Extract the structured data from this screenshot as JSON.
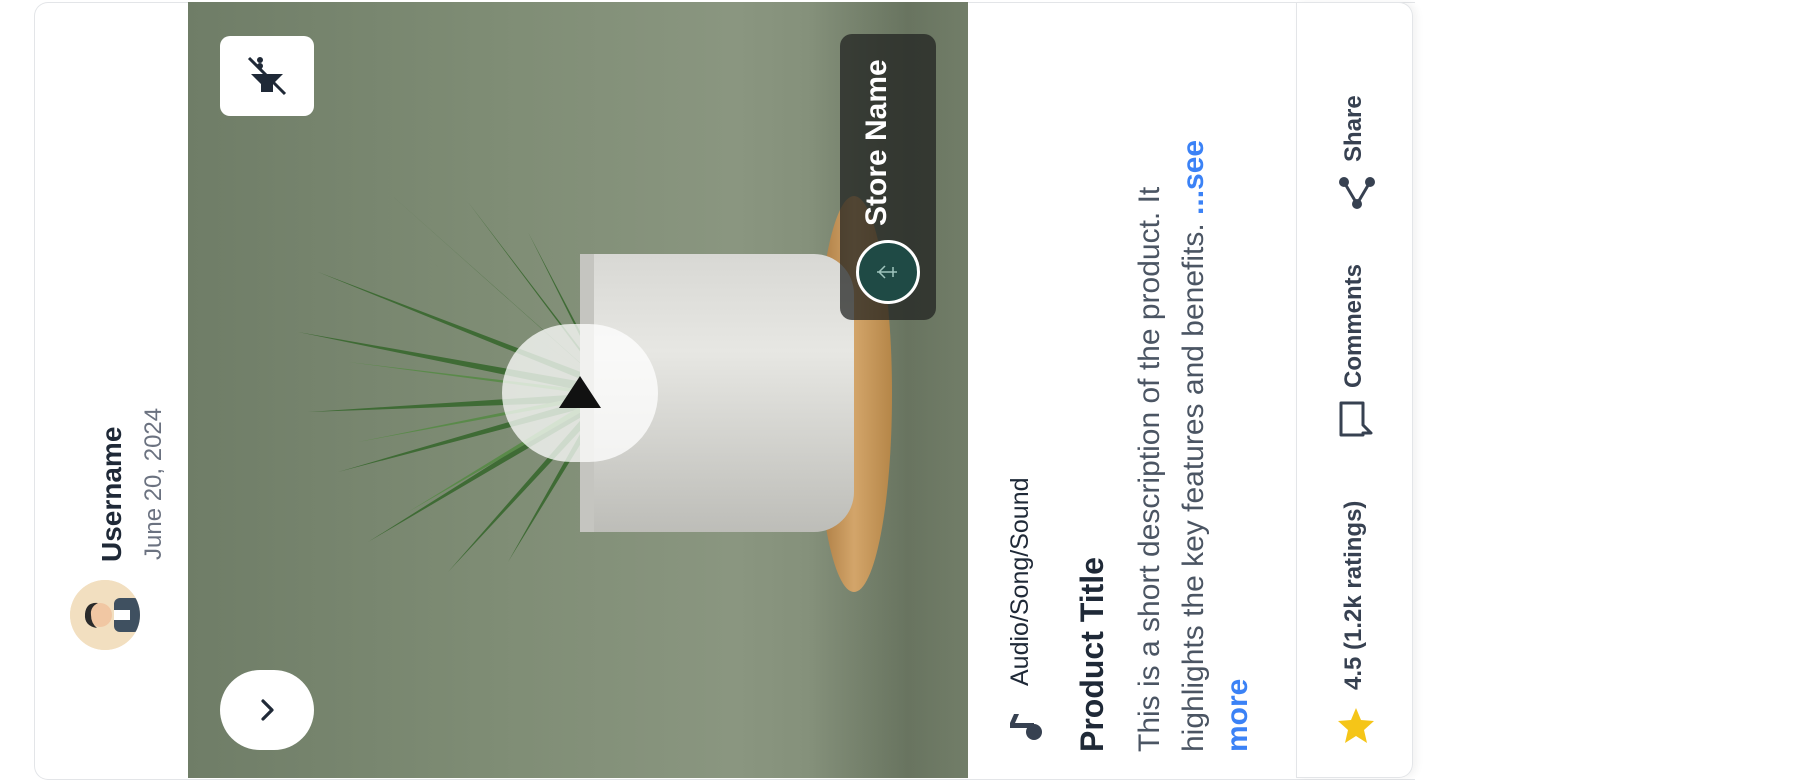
{
  "header": {
    "username": "Username",
    "date": "June 20, 2024"
  },
  "media": {
    "store_name": "Store Name",
    "icons": {
      "mute": "volume-off-icon",
      "play": "play-icon",
      "next": "chevron-right-icon"
    }
  },
  "info": {
    "audio_label": "Audio/Song/Sound",
    "product_title": "Product Title",
    "description": "This is a short description of the product. It highlights the key features and benefits.",
    "see_more": "...see more"
  },
  "actions": {
    "rating": "4.5 (1.2k ratings)",
    "comments": "Comments",
    "share": "Share"
  },
  "colors": {
    "accent_link": "#3b82f6",
    "star": "#f5c518",
    "text_primary": "#1f2937"
  }
}
